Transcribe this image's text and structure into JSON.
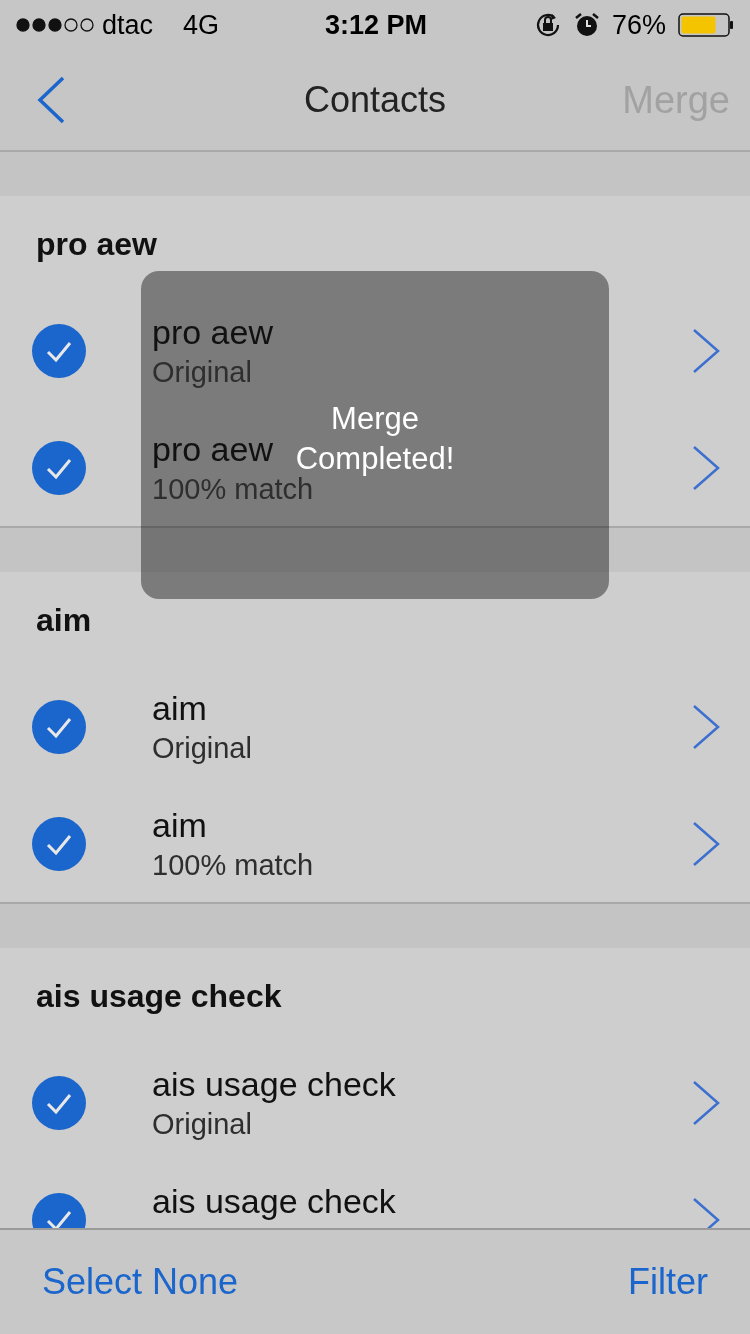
{
  "status_bar": {
    "carrier": "dtac",
    "network": "4G",
    "time": "3:12 PM",
    "battery": "76%"
  },
  "nav": {
    "title": "Contacts",
    "action": {
      "label": "Merge",
      "disabled": true
    }
  },
  "groups": [
    {
      "title": "pro aew",
      "contacts": [
        {
          "name": "pro aew",
          "detail": "Original",
          "checked": true
        },
        {
          "name": "pro aew",
          "detail": "100% match",
          "checked": true
        }
      ]
    },
    {
      "title": "aim",
      "contacts": [
        {
          "name": "aim",
          "detail": "Original",
          "checked": true
        },
        {
          "name": "aim",
          "detail": "100% match",
          "checked": true
        }
      ]
    },
    {
      "title": "ais usage check",
      "contacts": [
        {
          "name": "ais usage check",
          "detail": "Original",
          "checked": true
        },
        {
          "name": "ais usage check",
          "checked": true
        }
      ]
    }
  ],
  "toast": {
    "message": "Merge Completed!"
  },
  "toolbar": {
    "left": "Select None",
    "right": "Filter"
  }
}
